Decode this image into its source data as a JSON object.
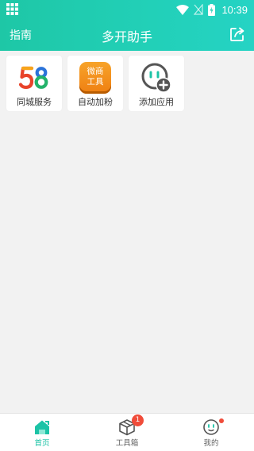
{
  "status_bar": {
    "time": "10:39"
  },
  "header": {
    "left_link": "指南",
    "title": "多开助手",
    "share_icon": "share-icon"
  },
  "apps": [
    {
      "label": "同城服务",
      "icon": "58-logo-icon",
      "logo_text": "58"
    },
    {
      "label": "自动加粉",
      "icon": "weishang-tool-icon",
      "logo_line1": "微商",
      "logo_line2": "工具"
    },
    {
      "label": "添加应用",
      "icon": "add-app-icon"
    }
  ],
  "bottom_nav": {
    "items": [
      {
        "label": "首页",
        "icon": "home-icon",
        "active": true
      },
      {
        "label": "工具箱",
        "icon": "toolbox-icon",
        "badge": "1"
      },
      {
        "label": "我的",
        "icon": "profile-icon",
        "dot": true
      }
    ]
  },
  "colors": {
    "accent": "#1ec7a6",
    "badge": "#f04c3a"
  }
}
